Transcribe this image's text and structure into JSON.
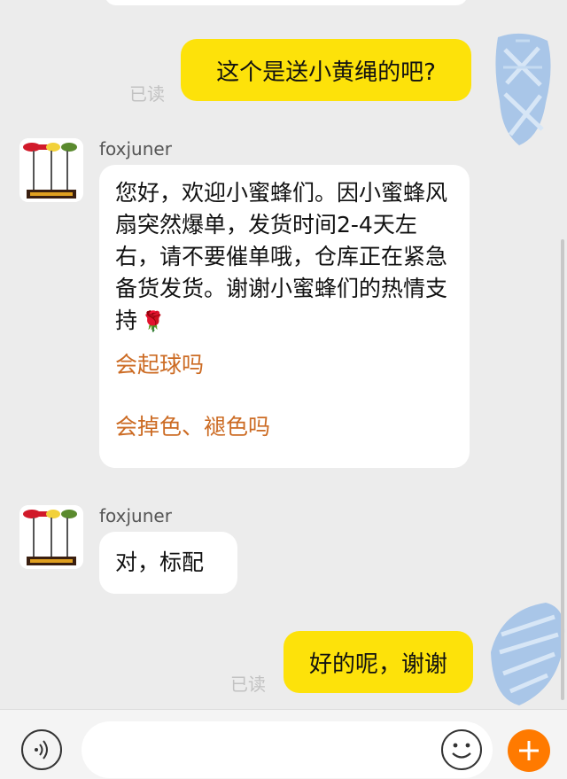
{
  "conversation": {
    "messages": [
      {
        "direction": "out",
        "text": "这个是送小黄绳的吧?",
        "status": "已读"
      },
      {
        "direction": "in",
        "sender": "foxjuner",
        "text": "您好，欢迎小蜜蜂们。因小蜜蜂风扇突然爆单，发货时间2-4天左右，请不要催单哦，仓库正在紧急备货发货。谢谢小蜜蜂们的热情支持",
        "emoji": "rose",
        "quick_questions": [
          "会起球吗",
          "会掉色、褪色吗"
        ]
      },
      {
        "direction": "in",
        "sender": "foxjuner",
        "text": "对，标配"
      },
      {
        "direction": "out",
        "text": "好的呢，谢谢",
        "status": "已读"
      }
    ]
  },
  "input_bar": {
    "placeholder": "",
    "icons": [
      "voice-icon",
      "emoji-icon",
      "plus-icon"
    ]
  },
  "colors": {
    "background": "#ececec",
    "outgoing_bubble": "#fde20a",
    "incoming_bubble": "#ffffff",
    "link": "#cc6b23",
    "plus_button": "#ff7a00"
  }
}
